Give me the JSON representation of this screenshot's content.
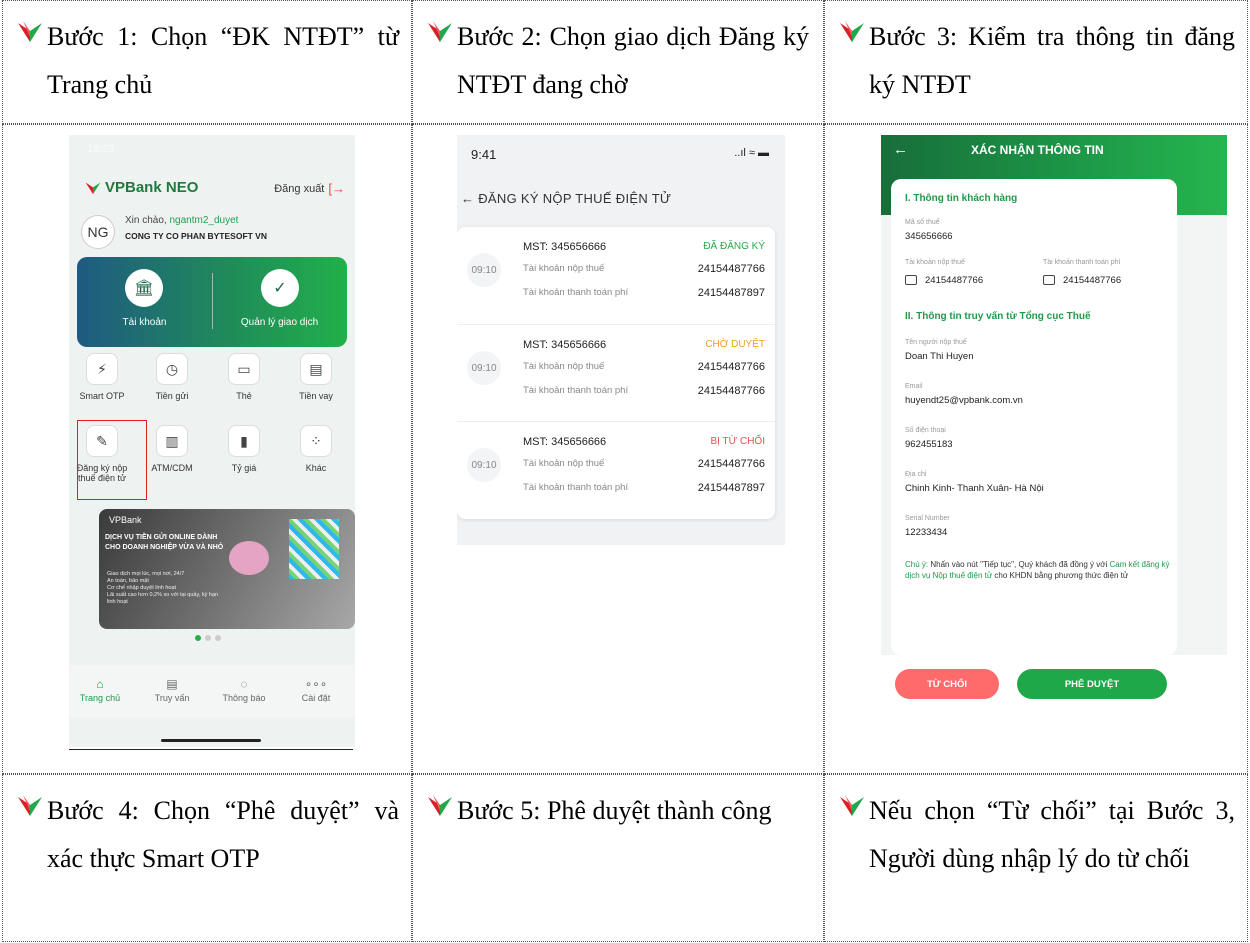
{
  "steps": {
    "s1": "Bước 1: Chọn “ĐK NTĐT” từ Trang chủ",
    "s2": "Bước 2: Chọn giao dịch Đăng ký NTĐT đang chờ",
    "s3": "Bước 3: Kiểm tra thông tin đăng ký NTĐT",
    "s4": "Bước 4: Chọn “Phê duyệt” và xác thực Smart OTP",
    "s5": "Bước 5: Phê duyệt thành công",
    "s6": "Nếu chọn “Từ chối” tại Bước 3, Người dùng nhập lý do từ chối"
  },
  "colors": {
    "bullet_red": "#d92027",
    "bullet_green": "#22a84a",
    "brand_green": "#1f9a4a"
  },
  "home": {
    "time": "18:23",
    "logo": "VPBank NEO",
    "logout": "Đăng xuất",
    "avatar": "NG",
    "hello_prefix": "Xin chào, ",
    "user": "ngantm2_duyet",
    "company": "CONG TY CO PHAN BYTESOFT VN",
    "card": {
      "account": "Tài khoản",
      "manage": "Quản lý giao dịch"
    },
    "features": [
      {
        "label": "Smart OTP",
        "icon": "⚡"
      },
      {
        "label": "Tiền gửi",
        "icon": "◷"
      },
      {
        "label": "Thẻ",
        "icon": "▭"
      },
      {
        "label": "Tiền vay",
        "icon": "▤"
      },
      {
        "label": "Đăng ký nộp thuế điện tử",
        "icon": "✎"
      },
      {
        "label": "ATM/CDM",
        "icon": "▥"
      },
      {
        "label": "Tỷ giá",
        "icon": "▮"
      },
      {
        "label": "Khác",
        "icon": "⁘"
      }
    ],
    "banner": {
      "logo": "VPBank",
      "title": "DỊCH VỤ TIỀN GỬI ONLINE DÀNH CHO DOANH NGHIỆP VỪA VÀ NHỎ",
      "points": [
        "Giao dịch mọi lúc, mọi nơi, 24/7",
        "An toàn, bảo mật",
        "Cơ chế nhập duyệt linh hoạt",
        "Lãi suất cao hơn 0,2% so với tại quầy, kỳ hạn linh hoạt"
      ]
    },
    "tabs": [
      "Trang chủ",
      "Truy vấn",
      "Thông báo",
      "Cài đặt"
    ]
  },
  "list": {
    "time": "9:41",
    "status_icons": "..ıl ≈ ▬",
    "title": "ĐĂNG KÝ NỘP THUẾ ĐIỆN TỬ",
    "items": [
      {
        "time": "09:10",
        "mst": "MST: 345656666",
        "status": "ĐÃ ĐĂNG KÝ",
        "status_color": "#2aa84a",
        "acc_label": "Tài khoản nộp thuế",
        "acc": "24154487766",
        "fee_label": "Tài khoản thanh toán phí",
        "fee": "24154487897"
      },
      {
        "time": "09:10",
        "mst": "MST: 345656666",
        "status": "CHỜ DUYỆT",
        "status_color": "#f0a020",
        "acc_label": "Tài khoản nộp thuế",
        "acc": "24154487766",
        "fee_label": "Tài khoản thanh toán phí",
        "fee": "24154487766"
      },
      {
        "time": "09:10",
        "mst": "MST: 345656666",
        "status": "BỊ TỪ CHỐI",
        "status_color": "#e85050",
        "acc_label": "Tài khoản nộp thuế",
        "acc": "24154487766",
        "fee_label": "Tài khoản thanh toán phí",
        "fee": "24154487897"
      }
    ]
  },
  "confirm": {
    "title": "XÁC NHẬN THÔNG TIN",
    "sec1": "I. Thông tin khách hàng",
    "mst_label": "Mã số thuế",
    "mst": "345656666",
    "acc_label": "Tài khoản nộp thuế",
    "acc": "24154487766",
    "fee_label": "Tài khoản thanh toán phí",
    "fee": "24154487766",
    "sec2": "II. Thông tin truy vấn từ Tổng cục Thuế",
    "name_label": "Tên người nộp thuế",
    "name": "Doan Thi Huyen",
    "email_label": "Email",
    "email": "huyendt25@vpbank.com.vn",
    "phone_label": "Số điện thoại",
    "phone": "962455183",
    "addr_label": "Địa chỉ",
    "addr": "Chinh Kinh- Thanh Xuân- Hà Nội",
    "serial_label": "Serial Number",
    "serial": "12233434",
    "note_prefix": "Chú ý: ",
    "note_a": "Nhấn vào nút \"Tiếp tục\", Quý khách đã đồng ý với ",
    "note_link": "Cam kết đăng ký dịch vụ Nộp thuế điện tử",
    "note_b": " cho KHDN bằng phương thức điện tử",
    "reject": "TỪ CHỐI",
    "approve": "PHÊ DUYỆT"
  }
}
